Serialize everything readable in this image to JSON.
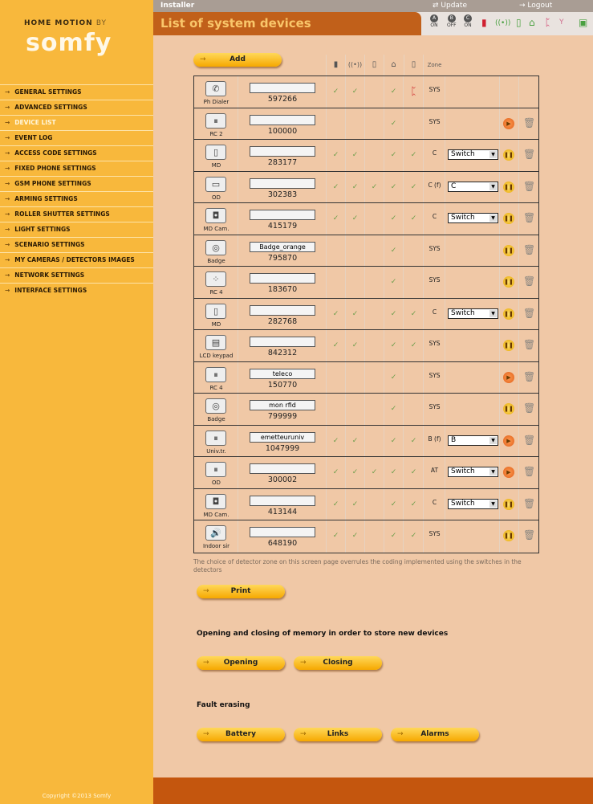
{
  "sidebar": {
    "logo_top": "HOME MOTION",
    "logo_by": "BY",
    "logo": "somfy",
    "items": [
      {
        "label": "GENERAL SETTINGS"
      },
      {
        "label": "ADVANCED SETTINGS"
      },
      {
        "label": "DEVICE LIST",
        "active": true
      },
      {
        "label": "EVENT LOG"
      },
      {
        "label": "ACCESS CODE SETTINGS"
      },
      {
        "label": "FIXED PHONE SETTINGS"
      },
      {
        "label": "GSM PHONE SETTINGS"
      },
      {
        "label": "ARMING SETTINGS"
      },
      {
        "label": "ROLLER SHUTTER SETTINGS"
      },
      {
        "label": "LIGHT SETTINGS"
      },
      {
        "label": "SCENARIO SETTINGS"
      },
      {
        "label": "MY CAMERAS / DETECTORS IMAGES"
      },
      {
        "label": "NETWORK SETTINGS"
      },
      {
        "label": "INTERFACE SETTINGS"
      }
    ],
    "copyright": "Copyright ©2013 Somfy"
  },
  "topbar": {
    "user": "Installer",
    "update": "Update",
    "logout": "Logout"
  },
  "header": {
    "title": "List of system devices",
    "zones": [
      {
        "letter": "A",
        "state": "ON"
      },
      {
        "letter": "B",
        "state": "OFF"
      },
      {
        "letter": "C",
        "state": "ON"
      }
    ]
  },
  "add_label": "Add",
  "columns": {
    "zone": "Zone",
    "icons": [
      "battery-icon",
      "radio-signal-icon",
      "door-icon",
      "house-icon",
      "tamper-icon"
    ]
  },
  "devices": [
    {
      "type": "Ph Dialer",
      "icon": "✆",
      "name": "",
      "id": "597266",
      "checks": [
        1,
        1,
        0,
        1,
        "flag"
      ],
      "zone": "SYS",
      "select": "",
      "action": "",
      "delete": false
    },
    {
      "type": "RC 2",
      "icon": "⏸",
      "name": "",
      "id": "100000",
      "checks": [
        0,
        0,
        0,
        1,
        0
      ],
      "zone": "SYS",
      "select": "",
      "action": "play",
      "delete": true
    },
    {
      "type": "MD",
      "icon": "▯",
      "name": "",
      "id": "283177",
      "checks": [
        1,
        1,
        0,
        1,
        1
      ],
      "zone": "C",
      "select": "Switch",
      "action": "pause",
      "delete": true
    },
    {
      "type": "OD",
      "icon": "▭",
      "name": "",
      "id": "302383",
      "checks": [
        1,
        1,
        1,
        1,
        1
      ],
      "zone": "C (f)",
      "select": "C",
      "action": "pause",
      "delete": true
    },
    {
      "type": "MD Cam.",
      "icon": "◘",
      "name": "",
      "id": "415179",
      "checks": [
        1,
        1,
        0,
        1,
        1
      ],
      "zone": "C",
      "select": "Switch",
      "action": "pause",
      "delete": true
    },
    {
      "type": "Badge",
      "icon": "◎",
      "name": "Badge_orange",
      "id": "795870",
      "checks": [
        0,
        0,
        0,
        1,
        0
      ],
      "zone": "SYS",
      "select": "",
      "action": "pause",
      "delete": true
    },
    {
      "type": "RC 4",
      "icon": "⁘",
      "name": "",
      "id": "183670",
      "checks": [
        0,
        0,
        0,
        1,
        0
      ],
      "zone": "SYS",
      "select": "",
      "action": "pause",
      "delete": true
    },
    {
      "type": "MD",
      "icon": "▯",
      "name": "",
      "id": "282768",
      "checks": [
        1,
        1,
        0,
        1,
        1
      ],
      "zone": "C",
      "select": "Switch",
      "action": "pause",
      "delete": true
    },
    {
      "type": "LCD keypad",
      "icon": "▤",
      "name": "",
      "id": "842312",
      "checks": [
        1,
        1,
        0,
        1,
        1
      ],
      "zone": "SYS",
      "select": "",
      "action": "pause",
      "delete": true
    },
    {
      "type": "RC 4",
      "icon": "⏸",
      "name": "teleco",
      "id": "150770",
      "checks": [
        0,
        0,
        0,
        1,
        0
      ],
      "zone": "SYS",
      "select": "",
      "action": "play",
      "delete": true
    },
    {
      "type": "Badge",
      "icon": "◎",
      "name": "mon rfid",
      "id": "799999",
      "checks": [
        0,
        0,
        0,
        1,
        0
      ],
      "zone": "SYS",
      "select": "",
      "action": "pause",
      "delete": true
    },
    {
      "type": "Univ.tr.",
      "icon": "⏸",
      "name": "emetteuruniv",
      "id": "1047999",
      "checks": [
        1,
        1,
        0,
        1,
        1
      ],
      "zone": "B (f)",
      "select": "B",
      "action": "play",
      "delete": true
    },
    {
      "type": "OD",
      "icon": "⏸",
      "name": "",
      "id": "300002",
      "checks": [
        1,
        1,
        1,
        1,
        1
      ],
      "zone": "AT",
      "select": "Switch",
      "action": "play",
      "delete": true
    },
    {
      "type": "MD Cam.",
      "icon": "◘",
      "name": "",
      "id": "413144",
      "checks": [
        1,
        1,
        0,
        1,
        1
      ],
      "zone": "C",
      "select": "Switch",
      "action": "pause",
      "delete": true
    },
    {
      "type": "Indoor sir",
      "icon": "🔊",
      "name": "",
      "id": "648190",
      "checks": [
        1,
        1,
        0,
        1,
        1
      ],
      "zone": "SYS",
      "select": "",
      "action": "pause",
      "delete": true
    }
  ],
  "note": "The choice of detector zone on this screen page overrules the coding implemented using the switches in the detectors",
  "print_label": "Print",
  "memory": {
    "heading": "Opening and closing of memory in order to store new devices",
    "opening": "Opening",
    "closing": "Closing"
  },
  "fault": {
    "heading": "Fault erasing",
    "battery": "Battery",
    "links": "Links",
    "alarms": "Alarms"
  },
  "colors": {
    "sidebar": "#f8b83c",
    "content": "#f0c8a6",
    "title_tab": "#c1601a",
    "footer": "#c4560e"
  }
}
